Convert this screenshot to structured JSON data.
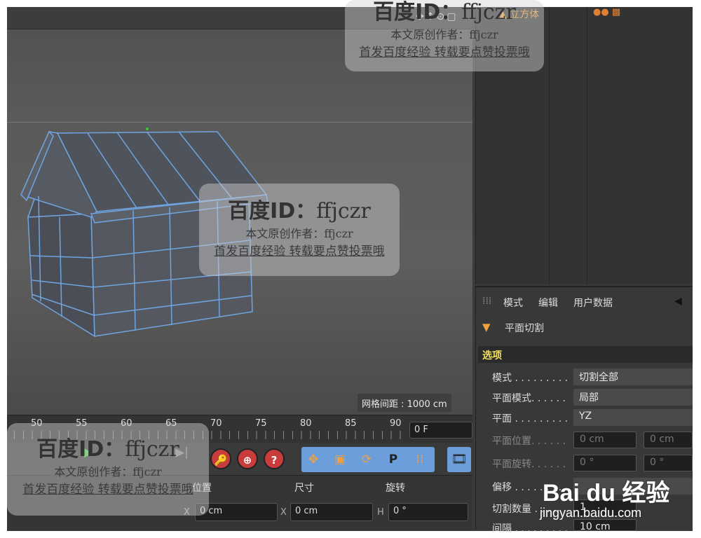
{
  "viewport": {
    "grid_label": "网格间距 : 1000 cm",
    "gizmo": "✥↕⊙▢"
  },
  "timeline": {
    "ticks": [
      "50",
      "55",
      "60",
      "65",
      "70",
      "75",
      "80",
      "85",
      "90"
    ],
    "current_frame": "0 F"
  },
  "transport": {
    "record_buttons": [
      "🔑",
      "⊕",
      "?"
    ],
    "tool_icons": [
      "✥",
      "▣",
      "⟳",
      "P",
      "⁞⁞"
    ]
  },
  "coords": {
    "headers": [
      "位置",
      "尺寸",
      "旋转"
    ],
    "fields": [
      {
        "axis": "X",
        "value": "0 cm"
      },
      {
        "axis": "X",
        "value": "0 cm"
      },
      {
        "axis": "H",
        "value": "0 °"
      }
    ]
  },
  "object_manager": {
    "object_name": "立方体"
  },
  "attributes": {
    "menu": [
      "模式",
      "编辑",
      "用户数据"
    ],
    "title": "平面切割",
    "section": "选项",
    "rows": [
      {
        "label": "模式 . . . . . . . . .",
        "value": "切割全部",
        "dim": false
      },
      {
        "label": "平面模式. . . . . .",
        "value": "局部",
        "dim": false
      },
      {
        "label": "平面 . . . . . . . . .",
        "value": "YZ",
        "dim": false
      },
      {
        "label": "平面位置. . . . . .",
        "value": "0 cm",
        "value2": "0 cm",
        "dim": true
      },
      {
        "label": "平面旋转. . . . . .",
        "value": "0 °",
        "value2": "0 °",
        "dim": true
      },
      {
        "label": "偏移 . . . . . . . . .",
        "value": "",
        "dim": false
      },
      {
        "label": "切割数量 . . . .",
        "value": "1",
        "dim": false
      },
      {
        "label": "间隔 . . . . . . . . .",
        "value": "10 cm",
        "dim": false
      }
    ]
  },
  "watermark": {
    "title": "百度ID：",
    "user": "ffjczr",
    "line2": "本文原创作者：ffjczr",
    "line3": "首发百度经验 转载要点赞投票哦"
  },
  "baidu": {
    "logo": "Bai du 经验",
    "url": "jingyan.baidu.com"
  }
}
